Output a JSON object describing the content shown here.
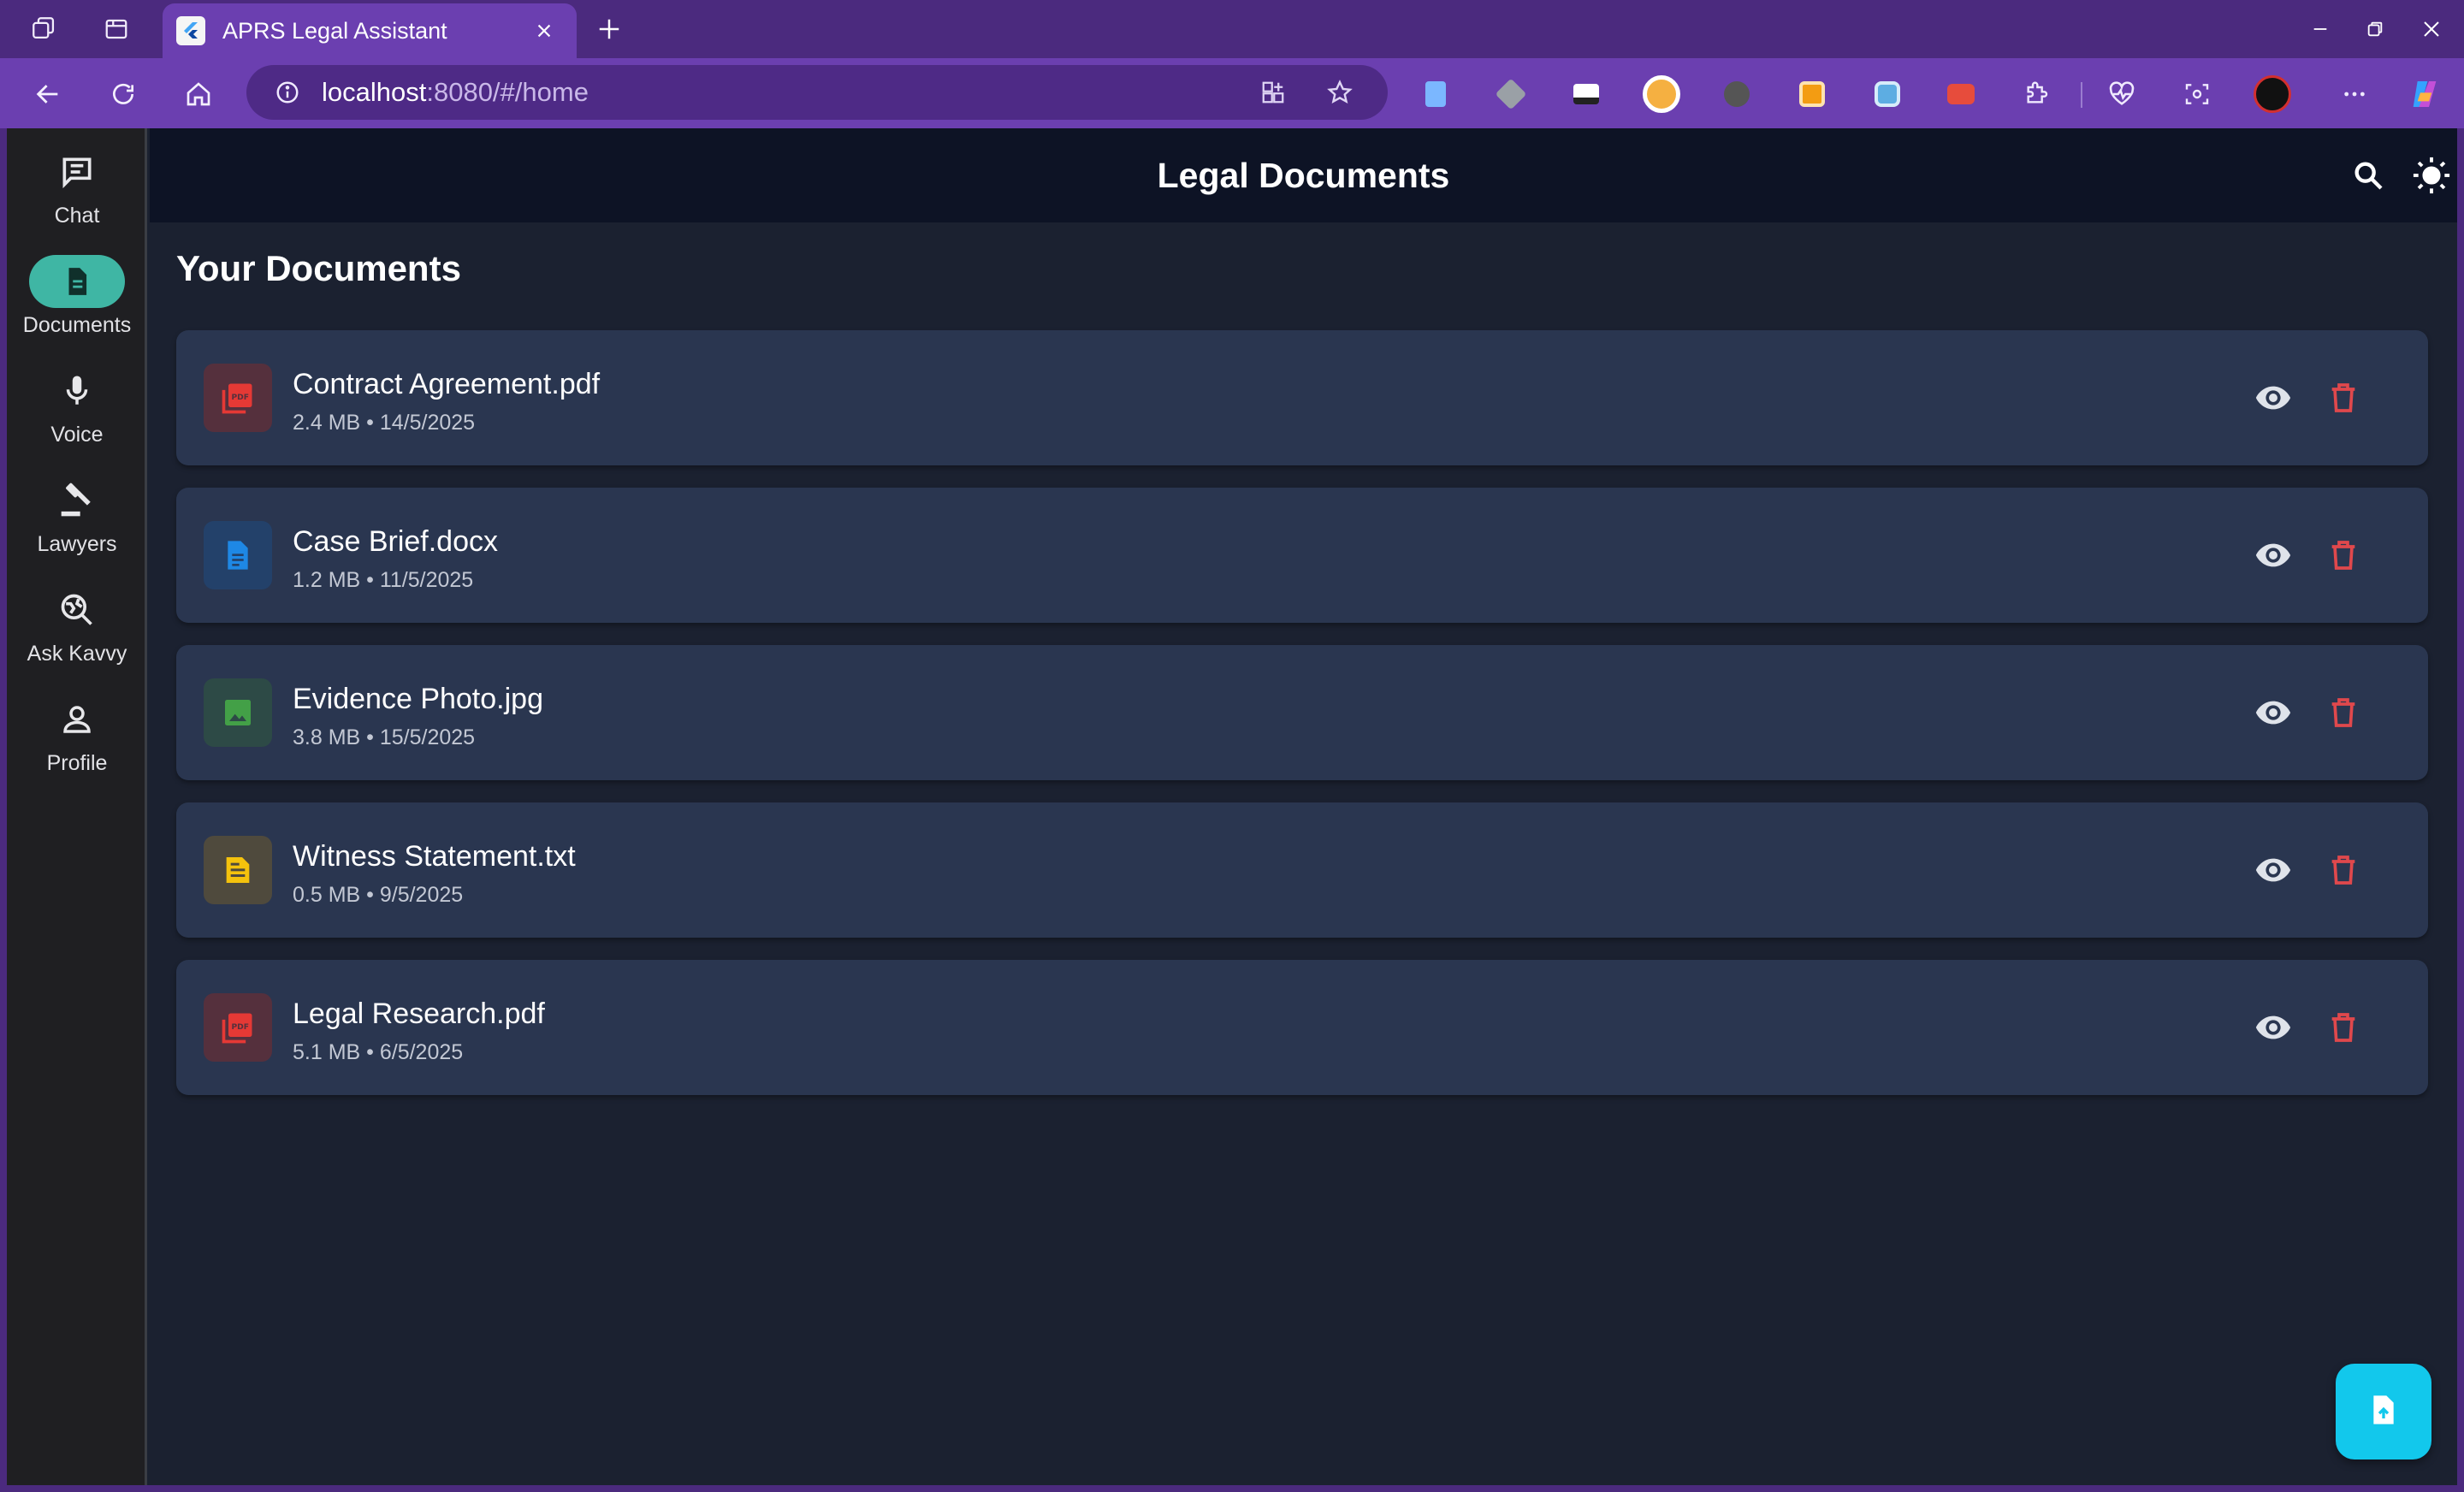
{
  "browser": {
    "tab_title": "APRS Legal Assistant",
    "url_host": "localhost",
    "url_rest": ":8080/#/home",
    "extensions": [
      {
        "name": "extension-1",
        "color": "#7bb7ff"
      },
      {
        "name": "extension-2",
        "color": "#9aa0a6"
      },
      {
        "name": "extension-3",
        "color": "#ffffff"
      },
      {
        "name": "extension-4",
        "color": "#f5b041"
      },
      {
        "name": "extension-5",
        "color": "#555555"
      },
      {
        "name": "extension-6",
        "color": "#f39c12"
      },
      {
        "name": "extension-7",
        "color": "#5dade2"
      },
      {
        "name": "extension-8",
        "color": "#e74c3c"
      }
    ]
  },
  "sidebar": {
    "items": [
      {
        "label": "Chat",
        "icon": "chat-icon",
        "active": false
      },
      {
        "label": "Documents",
        "icon": "document-icon",
        "active": true
      },
      {
        "label": "Voice",
        "icon": "microphone-icon",
        "active": false
      },
      {
        "label": "Lawyers",
        "icon": "gavel-icon",
        "active": false
      },
      {
        "label": "Ask Kavvy",
        "icon": "search-globe-icon",
        "active": false
      },
      {
        "label": "Profile",
        "icon": "person-icon",
        "active": false
      }
    ]
  },
  "header": {
    "title": "Legal Documents"
  },
  "main": {
    "section_title": "Your Documents",
    "documents": [
      {
        "name": "Contract Agreement.pdf",
        "meta": "2.4 MB • 14/5/2025",
        "type": "pdf",
        "icon_color": "#e53935",
        "icon_bg": "#55303d"
      },
      {
        "name": "Case Brief.docx",
        "meta": "1.2 MB • 11/5/2025",
        "type": "doc",
        "icon_color": "#1e88e5",
        "icon_bg": "#23416a"
      },
      {
        "name": "Evidence Photo.jpg",
        "meta": "3.8 MB • 15/5/2025",
        "type": "image",
        "icon_color": "#43a047",
        "icon_bg": "#2d4a46"
      },
      {
        "name": "Witness Statement.txt",
        "meta": "0.5 MB • 9/5/2025",
        "type": "text",
        "icon_color": "#f4c20d",
        "icon_bg": "#4f4a3d"
      },
      {
        "name": "Legal Research.pdf",
        "meta": "5.1 MB • 6/5/2025",
        "type": "pdf",
        "icon_color": "#e53935",
        "icon_bg": "#55303d"
      }
    ]
  },
  "colors": {
    "accent": "#3fb6a4",
    "fab": "#12c8ec",
    "delete": "#e0484c"
  }
}
